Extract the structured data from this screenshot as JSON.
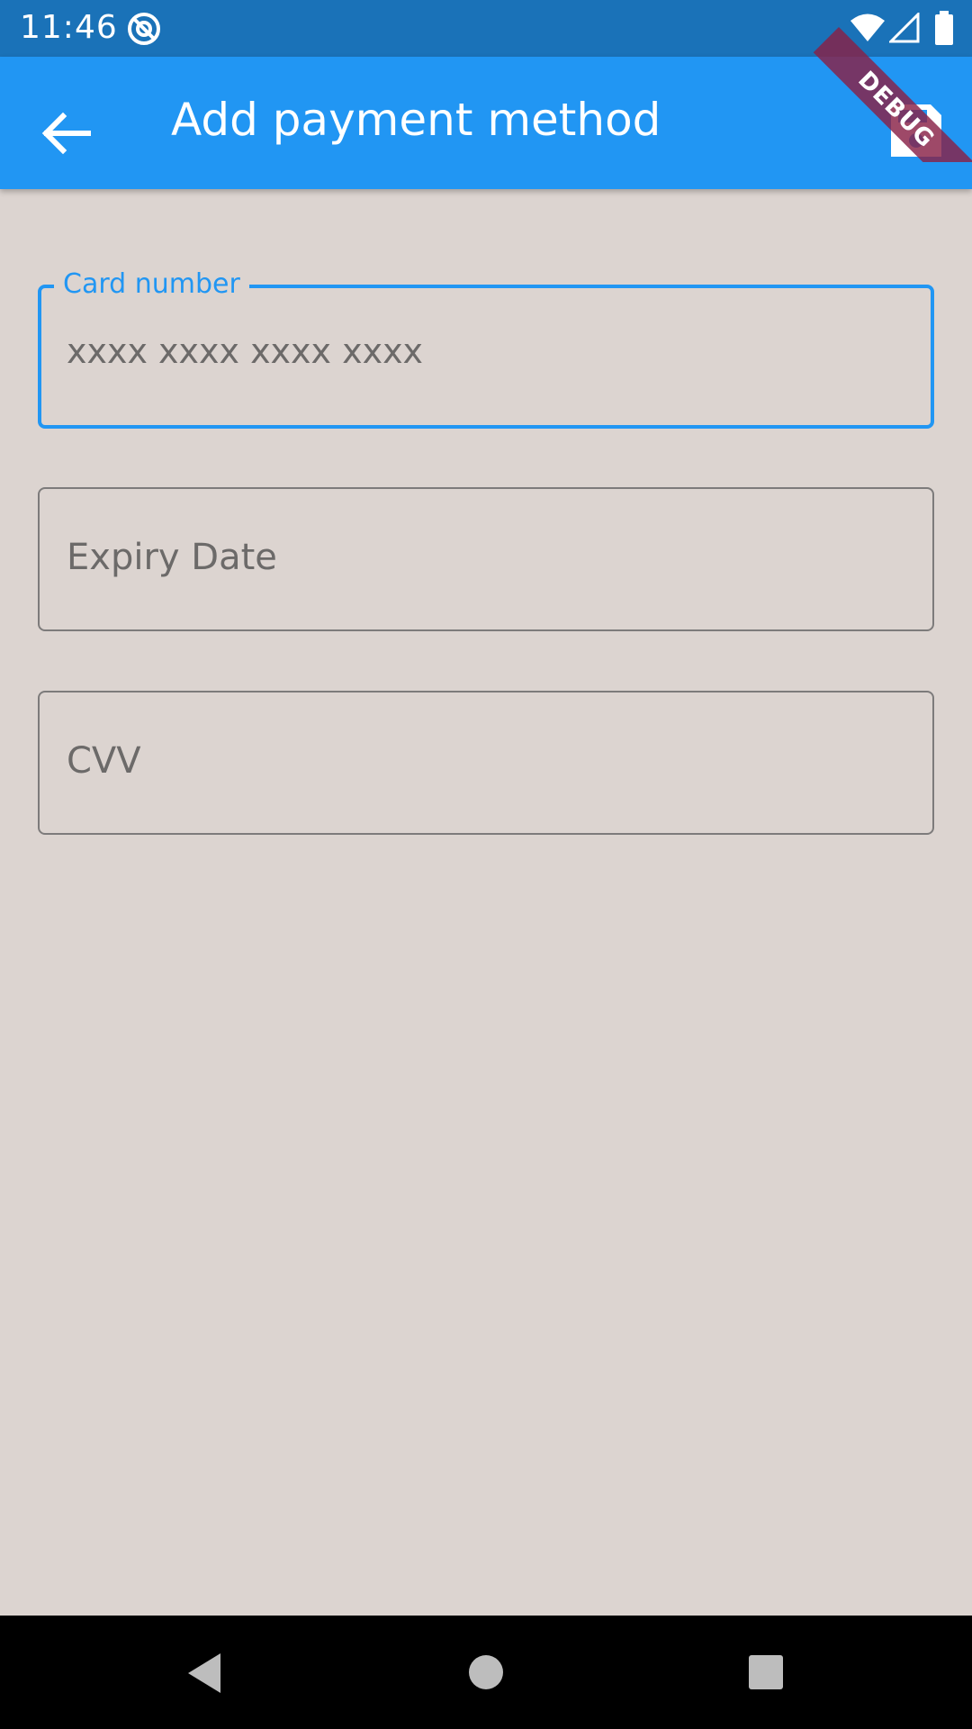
{
  "status_bar": {
    "time": "11:46",
    "app_icon": "at-sign-icon",
    "wifi_icon": "wifi-icon",
    "signal_icon": "cell-signal-icon",
    "battery_icon": "battery-icon"
  },
  "app_bar": {
    "title": "Add payment method",
    "back_icon": "arrow-back-icon",
    "save_icon": "save-floppy-icon",
    "color": "#2196f3"
  },
  "debug_banner": {
    "label": "DEBUG"
  },
  "form": {
    "card_number": {
      "label": "Card number",
      "placeholder": "xxxx xxxx xxxx xxxx",
      "focused": true
    },
    "expiry_date": {
      "placeholder": "Expiry Date"
    },
    "cvv": {
      "placeholder": "CVV"
    }
  },
  "nav_bar": {
    "back_icon": "triangle-back-icon",
    "home_icon": "circle-home-icon",
    "recents_icon": "square-recents-icon"
  },
  "colors": {
    "status_bar": "#1a72b8",
    "accent": "#2196f3",
    "background": "#dcd4d0",
    "debug_ribbon": "#892147"
  }
}
